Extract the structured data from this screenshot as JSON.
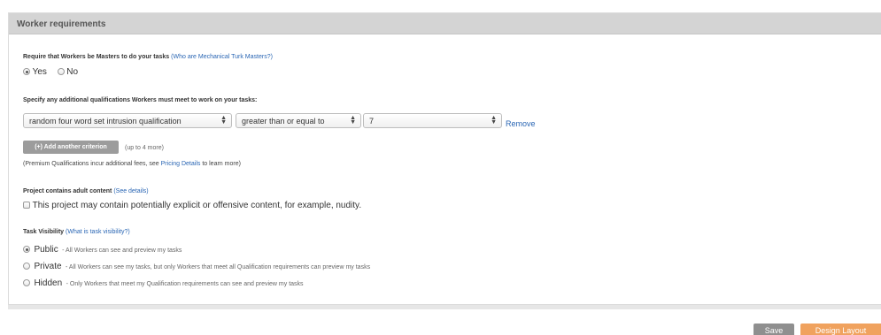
{
  "panel": {
    "title": "Worker requirements"
  },
  "masters": {
    "label": "Require that Workers be Masters to do your tasks",
    "help_link": "(Who are Mechanical Turk Masters?)",
    "options": [
      "Yes",
      "No"
    ],
    "selected": "Yes"
  },
  "qualifications": {
    "label": "Specify any additional qualifications Workers must meet to work on your tasks:",
    "qualification_value": "random four word set intrusion qualification",
    "comparator_value": "greater than or equal to",
    "threshold_value": "7",
    "remove_label": "Remove",
    "add_button_label": "(+) Add another criterion",
    "add_hint": "(up to 4 more)",
    "premium_note_pre": "(Premium Qualifications incur additional fees, see",
    "premium_link": "Pricing Details",
    "premium_note_post": "to learn more)"
  },
  "adult": {
    "label": "Project contains adult content",
    "help_link": "(See details)",
    "checkbox_label": "This project may contain potentially explicit or offensive content, for example, nudity.",
    "checked": false
  },
  "visibility": {
    "label": "Task Visibility",
    "help_link": "(What is task visibility?)",
    "selected": "Public",
    "options": [
      {
        "name": "Public",
        "desc": "- All Workers can see and preview my tasks"
      },
      {
        "name": "Private",
        "desc": "- All Workers can see my tasks, but only Workers that meet all Qualification requirements can preview my tasks"
      },
      {
        "name": "Hidden",
        "desc": "- Only Workers that meet my Qualification requirements can see and preview my tasks"
      }
    ]
  },
  "footer": {
    "save_label": "Save",
    "design_label": "Design Layout",
    "design_color": "#f0a25e"
  }
}
